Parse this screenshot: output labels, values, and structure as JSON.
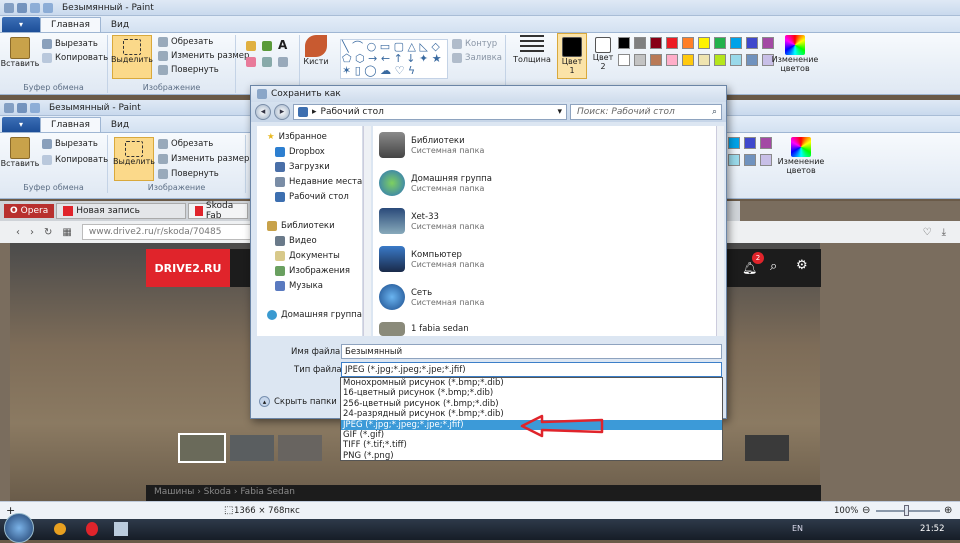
{
  "paint_back": {
    "title": "Безымянный - Paint",
    "file_tab": "▾",
    "tabs": [
      "Главная",
      "Вид"
    ],
    "clipboard": {
      "paste": "Вставить",
      "cut": "Вырезать",
      "copy": "Копировать",
      "caption": "Буфер обмена"
    },
    "image": {
      "select": "Выделить",
      "crop": "Обрезать",
      "resize": "Изменить размер",
      "rotate": "Повернуть",
      "caption": "Изображение"
    },
    "tools_label": "Кисти",
    "shapes": {
      "outline": "Контур",
      "fill": "Заливка"
    },
    "thickness": "Толщина",
    "color1": "Цвет 1",
    "color2": "Цвет 2",
    "edit_colors": "Изменение цветов"
  },
  "paint_front": {
    "title": "Безымянный - Paint",
    "tabs": [
      "Главная",
      "Вид"
    ],
    "clipboard": {
      "paste": "Вставить",
      "cut": "Вырезать",
      "copy": "Копировать",
      "caption": "Буфер обмена"
    },
    "image": {
      "select": "Выделить",
      "crop": "Обрезать",
      "resize": "Изменить размер",
      "rotate": "Повернуть",
      "caption": "Изображение"
    },
    "edit_colors": "Изменение цветов"
  },
  "palette": [
    "#000000",
    "#7f7f7f",
    "#880015",
    "#ed1c24",
    "#ff7f27",
    "#fff200",
    "#22b14c",
    "#00a2e8",
    "#3f48cc",
    "#a349a4",
    "#ffffff",
    "#c3c3c3",
    "#b97a57",
    "#ffaec9",
    "#ffc90e",
    "#efe4b0",
    "#b5e61d",
    "#99d9ea",
    "#7092be",
    "#c8bfe7"
  ],
  "browser": {
    "app": "Opera",
    "tabs": [
      "Новая запись",
      "Skoda Fab"
    ],
    "url": "www.drive2.ru/r/skoda/70485",
    "logo": "DRIVE2.RU",
    "notif_count": "2",
    "breadcrumb": "Машины › Skoda › Fabia Sedan"
  },
  "dialog": {
    "title": "Сохранить как",
    "location": "Рабочий стол",
    "search_placeholder": "Поиск: Рабочий стол",
    "nav": {
      "favorites": "Избранное",
      "items1": [
        "Dropbox",
        "Загрузки",
        "Недавние места",
        "Рабочий стол"
      ],
      "libraries": "Библиотеки",
      "items2": [
        "Видео",
        "Документы",
        "Изображения",
        "Музыка"
      ],
      "homegroup": "Домашняя группа"
    },
    "files": [
      {
        "name": "Библиотеки",
        "type": "Системная папка"
      },
      {
        "name": "Домашняя группа",
        "type": "Системная папка"
      },
      {
        "name": "Xet-33",
        "type": "Системная папка"
      },
      {
        "name": "Компьютер",
        "type": "Системная папка"
      },
      {
        "name": "Сеть",
        "type": "Системная папка"
      },
      {
        "name": "1 fabia sedan",
        "type": ""
      }
    ],
    "filename_label": "Имя файла:",
    "filename_value": "Безымянный",
    "filetype_label": "Тип файла:",
    "filetype_value": "JPEG (*.jpg;*.jpeg;*.jpe;*.jfif)",
    "hide_folders": "Скрыть папки",
    "type_options": [
      "Монохромный рисунок (*.bmp;*.dib)",
      "16-цветный рисунок (*.bmp;*.dib)",
      "256-цветный рисунок (*.bmp;*.dib)",
      "24-разрядный рисунок (*.bmp;*.dib)",
      "JPEG (*.jpg;*.jpeg;*.jpe;*.jfif)",
      "GIF (*.gif)",
      "TIFF (*.tif;*.tiff)",
      "PNG (*.png)"
    ],
    "selected_option": 4
  },
  "statusbar": {
    "dimensions": "1366 × 768пкс",
    "zoom": "100%"
  },
  "taskbar": {
    "lang": "EN",
    "time": "21:52"
  },
  "colors": {
    "accent_red": "#e0242b",
    "selection_blue": "#3c9ad8"
  }
}
